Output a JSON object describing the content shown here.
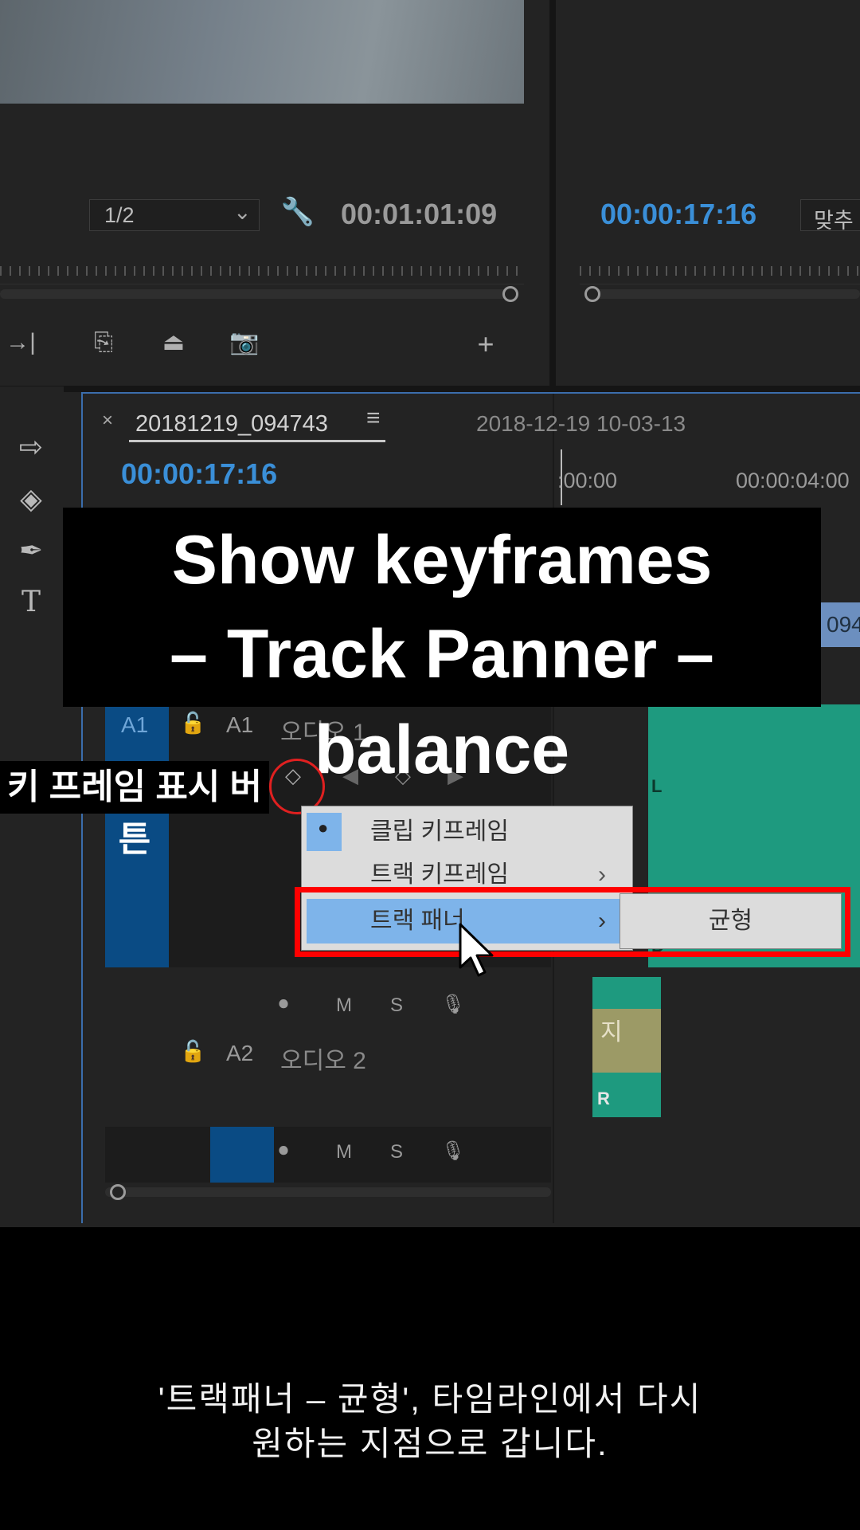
{
  "source_monitor": {
    "zoom": "1/2",
    "timecode": "00:01:01:09"
  },
  "program_monitor": {
    "timecode": "00:00:17:16",
    "fit_label": "맞추"
  },
  "timeline": {
    "tab_title": "20181219_094743",
    "clip_name": "2018-12-19 10-03-13",
    "timecode": "00:00:17:16",
    "ruler_start": ":00:00",
    "ruler_mark": "00:00:04:00",
    "clip_label_partial": "094",
    "tracks": [
      {
        "source": "A1",
        "target": "A1",
        "name": "오디오 1",
        "clip_channels": [
          "L",
          "R"
        ]
      },
      {
        "target": "A2",
        "name": "오디오 2",
        "clip_text": "지",
        "clip_channel": "R"
      }
    ],
    "track_buttons": {
      "mute": "M",
      "solo": "S"
    }
  },
  "overlay": {
    "title_line1": "Show keyframes",
    "title_line2": "– Track Panner – balance",
    "label": "키 프레임 표시 버튼"
  },
  "context_menu": {
    "items": [
      {
        "label": "클립 키프레임",
        "checked": true
      },
      {
        "label": "트랙 키프레임",
        "submenu": true
      },
      {
        "label": "트랙 패너",
        "submenu": true,
        "highlighted": true
      }
    ],
    "submenu_item": "균형"
  },
  "subtitle": {
    "line1": "'트랙패너 – 균형', 타임라인에서 다시",
    "line2": "원하는 지점으로 갑니다."
  },
  "colors": {
    "accent_blue": "#3a8fd8",
    "highlight": "#ff0000",
    "waveform": "#1e9a7f"
  }
}
